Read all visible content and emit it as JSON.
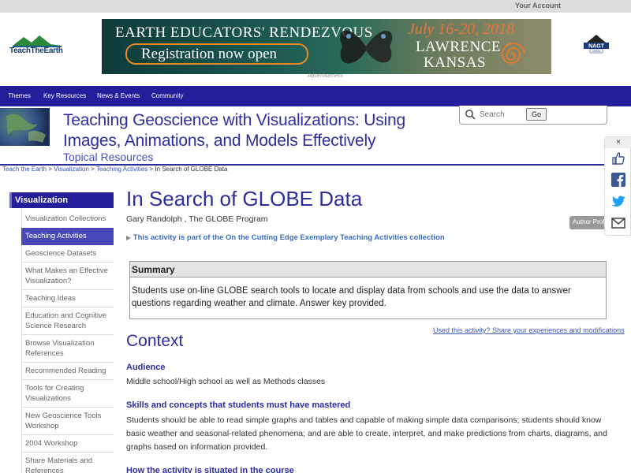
{
  "topbar": {
    "account": "Your Account"
  },
  "logo": {
    "text": "TeachTheEarth"
  },
  "banner": {
    "line1": "EARTH EDUCATORS' RENDEZVOUS",
    "line2": "Registration now open",
    "date": "July 16-20, 2018",
    "city": "LAWRENCE",
    "state": "KANSAS",
    "label": "Advertisement"
  },
  "nagt": {
    "text": "NAGT",
    "join": "JOIN ▸"
  },
  "nav": [
    "Themes",
    "Key Resources",
    "News & Events",
    "Community"
  ],
  "header": {
    "title_line1": "Teaching Geoscience with Visualizations: Using",
    "title_line2": "Images, Animations, and Models Effectively",
    "subtitle": "Topical Resources"
  },
  "search": {
    "placeholder": "Search",
    "go": "Go"
  },
  "breadcrumb": {
    "items": [
      "Teach the Earth",
      "Visualization",
      "Teaching Activities"
    ],
    "current": "In Search of GLOBE Data",
    "sep": " > "
  },
  "sidebar": {
    "title": "Visualization",
    "items": [
      "Visualization Collections",
      "Teaching Activities",
      "Geoscience Datasets",
      "What Makes an Effective Visualization?",
      "Teaching Ideas",
      "Education and Cognitive Science Research",
      "Browse Visualization References",
      "Recommended Reading",
      "Tools for Creating Visualizations",
      "New Geoscience Tools Workshop",
      "2004 Workshop",
      "Share Materials and References"
    ],
    "active_index": 1
  },
  "main": {
    "title": "In Search of GLOBE Data",
    "author": "Gary Randolph , The GLOBE Program",
    "author_tab": "Author Profile",
    "collection": "This activity is part of the On the Cutting Edge Exemplary Teaching Activities collection",
    "summary_head": "Summary",
    "summary_body": "Students use on-line GLOBE search tools to locate and display data from schools and use the data to answer questions regarding weather and climate. Answer key provided.",
    "used_link": "Used this activity? Share your experiences and modifications",
    "context": "Context",
    "audience_head": "Audience",
    "audience_body": "Middle school/High school as well as Methods classes",
    "skills_head": "Skills and concepts that students must have mastered",
    "skills_body": "Students should be able to read simple graphs and tables and capable of making simple data comparisons; students should know basic weather and seasonal-related phenomena; and are able to create, interpret, and make predictions from charts, diagrams, and graphs based on information provided.",
    "situated_head": "How the activity is situated in the course"
  },
  "share": {
    "close": "×"
  },
  "colors": {
    "nav": "#241e9c",
    "title": "#2b2da0",
    "link": "#3a56b0"
  }
}
